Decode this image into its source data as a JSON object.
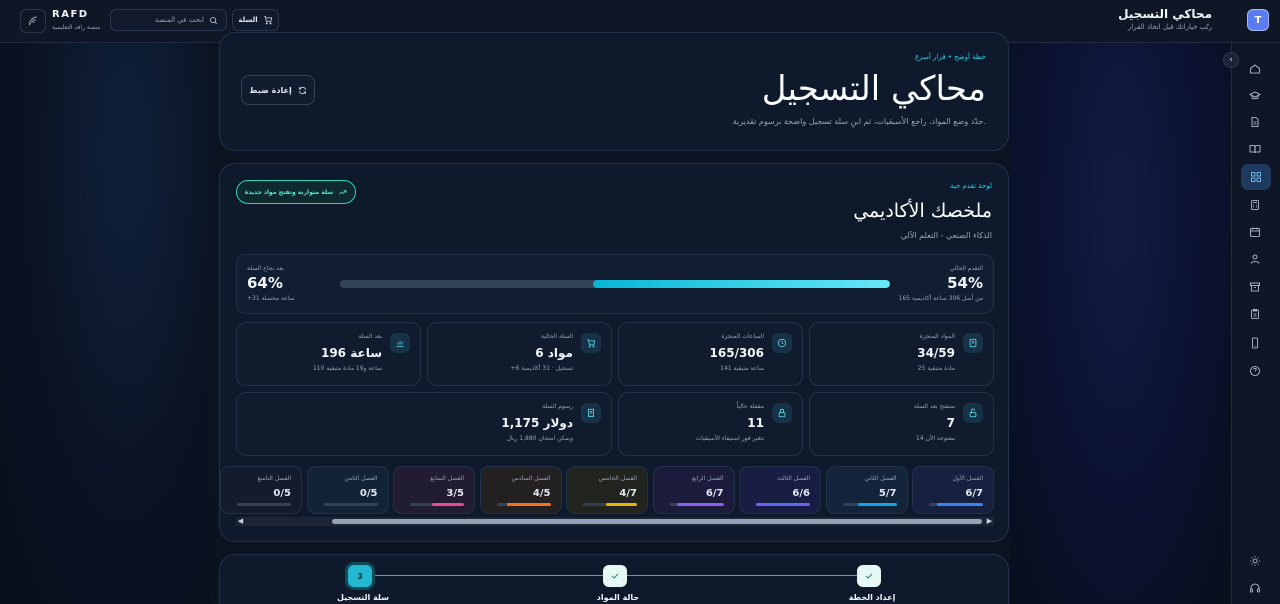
{
  "header": {
    "app_title": "محاكي التسجيل",
    "app_subtitle": "رتّب خياراتك قبل اتخاذ القرار",
    "avatar_initial": "T",
    "brand": "RAFD",
    "brand_subtitle": "منصة رافد التعليمية",
    "search_placeholder": "ابحث في المنصة",
    "cart_label": "السلة"
  },
  "hero": {
    "kicker": "خطة أوضح • قرار أسرع",
    "title": "محاكي التسجيل",
    "description": "حدّد وضع المواد، راجع الأسبقيات، ثم ابنِ سلة تسجيل واضحة برسوم تقديرية.",
    "reset_label": "إعادة ضبط"
  },
  "summary": {
    "kicker": "لوحة تقدم حية",
    "title": "ملخصك الأكاديمي",
    "subtitle": "الذكاء الصنعي - التعلم الآلي",
    "cta_label": "سلة متوازنة وتفتح مواد جديدة",
    "current_label": "التقدم الحالي",
    "current_value": "54%",
    "current_note": "165 من أصل 306 ساعة أكاديمية",
    "current_fraction": 0.54,
    "after_label": "بعد نجاح السلة",
    "after_value": "64%",
    "after_note": "+31 ساعة محتملة"
  },
  "stats": [
    {
      "title": "المواد المنجزة",
      "value": "34/59",
      "sub": "25 مادة متبقية",
      "icon": "book-icon"
    },
    {
      "title": "الساعات المنجزة",
      "value": "165/306",
      "sub": "141 ساعة متبقية",
      "icon": "clock-icon"
    },
    {
      "title": "السلة الحالية",
      "value": "6 مواد",
      "sub": "+6 تسجيل · 31 أكاديمية",
      "icon": "cart-icon"
    },
    {
      "title": "بعد السلة",
      "value": "196 ساعة",
      "sub": "110 ساعة و19 مادة متبقية",
      "icon": "bar-chart-icon"
    },
    {
      "title": "ستفتح بعد السلة",
      "value": "7",
      "sub": "14 مفتوحة الآن",
      "icon": "unlock-icon"
    },
    {
      "title": "مقفلة حالياً",
      "value": "11",
      "sub": "تتغير فور استيفاء الأسبقيات",
      "icon": "lock-icon"
    },
    {
      "title": "رسوم السلة",
      "value": "1,175 دولار",
      "sub": "ويمكن امتحان 1,880 ريال",
      "icon": "receipt-icon"
    }
  ],
  "semesters": [
    {
      "name": "الفصل الأول",
      "value": "6/7",
      "progress": 0.857,
      "color": "#3b82f6",
      "bg": "#15213f"
    },
    {
      "name": "الفصل الثاني",
      "value": "5/7",
      "progress": 0.714,
      "color": "#0ea5e9",
      "bg": "#12253a"
    },
    {
      "name": "الفصل الثالث",
      "value": "6/6",
      "progress": 1.0,
      "color": "#6366f1",
      "bg": "#191d44"
    },
    {
      "name": "الفصل الرابع",
      "value": "6/7",
      "progress": 0.857,
      "color": "#8b5cf6",
      "bg": "#1b1b3c"
    },
    {
      "name": "الفصل الخامس",
      "value": "4/7",
      "progress": 0.571,
      "color": "#eab308",
      "bg": "#22241f"
    },
    {
      "name": "الفصل السادس",
      "value": "4/5",
      "progress": 0.8,
      "color": "#f97316",
      "bg": "#232021"
    },
    {
      "name": "الفصل السابع",
      "value": "3/5",
      "progress": 0.6,
      "color": "#ec4899",
      "bg": "#221c30"
    },
    {
      "name": "الفصل الثامن",
      "value": "0/5",
      "progress": 0,
      "color": "#14b8a6",
      "bg": "#112334"
    },
    {
      "name": "الفصل التاسع",
      "value": "0/5",
      "progress": 0,
      "color": "#64748b",
      "bg": "#131c2c"
    }
  ],
  "steps": [
    {
      "label": "إعداد الخطة",
      "state": "done",
      "mark": ""
    },
    {
      "label": "حالة المواد",
      "state": "done",
      "mark": ""
    },
    {
      "label": "سلة التسجيل",
      "state": "current",
      "mark": "3"
    }
  ],
  "nav_icons": [
    "home-icon",
    "graduation-cap-icon",
    "document-icon",
    "open-book-icon",
    "dashboard-icon",
    "calculator-icon",
    "calendar-icon",
    "user-icon",
    "archive-icon",
    "clipboard-icon",
    "phone-icon",
    "help-icon",
    "sun-icon",
    "headset-icon"
  ]
}
